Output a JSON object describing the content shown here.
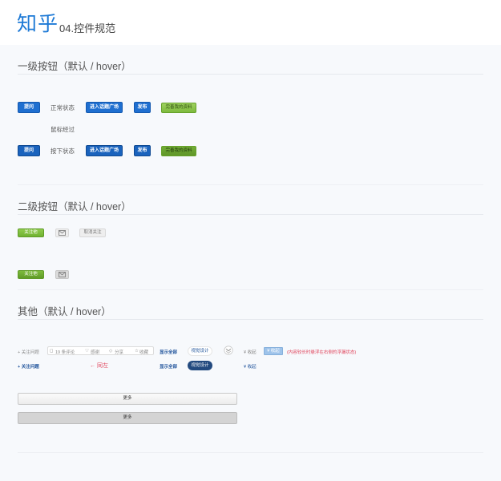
{
  "header": {
    "logo": "知乎",
    "subtitle": "04.控件规范"
  },
  "sections": {
    "primary": "一级按钮（默认 / hover）",
    "secondary": "二级按钮（默认 / hover）",
    "other": "其他（默认 / hover）"
  },
  "primary_buttons": {
    "ask": "提问",
    "normal_state": "正常状态",
    "hover_state": "鼠标经过",
    "pressed_state": "按下状态",
    "enter_square": "进入话题广场",
    "publish": "发布",
    "complete_profile": "完善我的资料"
  },
  "secondary_buttons": {
    "follow_him": "关注他",
    "unfollow": "取消关注"
  },
  "other": {
    "follow_question": "+ 关注问题",
    "comments": "19 条评论",
    "thanks": "感谢",
    "share": "分享",
    "favorite": "收藏",
    "show_all": "显示全部",
    "tag": "视觉设计",
    "fold": "收起",
    "fold_button": "收起",
    "fold_note": "(内容较长时悬浮在右侧的浮漏状态)",
    "same_left": "← 同左",
    "follow_question_hover": "+ 关注问题",
    "show_all_hover": "显示全部",
    "tag_hover": "视觉设计",
    "fold_hover": "收起",
    "more_normal": "更多",
    "more_hover": "更多"
  },
  "colors": {
    "brand": "#1e7ad6",
    "primary_button": "#1f6fd0",
    "green_button": "#7dba3d",
    "warning": "#e0455c"
  }
}
